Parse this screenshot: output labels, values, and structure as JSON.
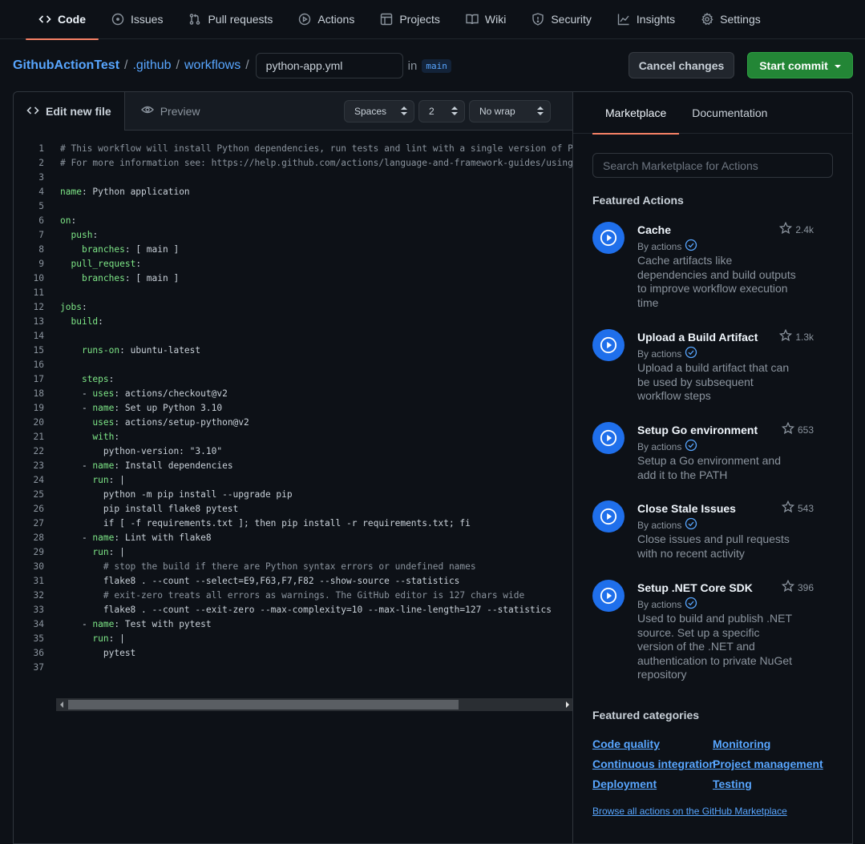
{
  "nav": {
    "tabs": [
      {
        "label": "Code",
        "icon": "code-icon",
        "active": true
      },
      {
        "label": "Issues",
        "icon": "issue-icon"
      },
      {
        "label": "Pull requests",
        "icon": "pull-request-icon"
      },
      {
        "label": "Actions",
        "icon": "play-icon"
      },
      {
        "label": "Projects",
        "icon": "table-icon"
      },
      {
        "label": "Wiki",
        "icon": "book-icon"
      },
      {
        "label": "Security",
        "icon": "shield-icon"
      },
      {
        "label": "Insights",
        "icon": "graph-icon"
      },
      {
        "label": "Settings",
        "icon": "gear-icon"
      }
    ]
  },
  "breadcrumb": {
    "repo": "GithubActionTest",
    "dir1": ".github",
    "dir2": "workflows",
    "sep": "/",
    "filename": "python-app.yml",
    "in_label": "in",
    "branch": "main"
  },
  "actions": {
    "cancel": "Cancel changes",
    "commit": "Start commit"
  },
  "editor": {
    "tab_edit": "Edit new file",
    "tab_preview": "Preview",
    "indent_mode": "Spaces",
    "indent_size": "2",
    "wrap_mode": "No wrap",
    "lines": [
      "# This workflow will install Python dependencies, run tests and lint with a single version of Pyt",
      "# For more information see: https://help.github.com/actions/language-and-framework-guides/using-p",
      "",
      "name: Python application",
      "",
      "on:",
      "  push:",
      "    branches: [ main ]",
      "  pull_request:",
      "    branches: [ main ]",
      "",
      "jobs:",
      "  build:",
      "",
      "    runs-on: ubuntu-latest",
      "",
      "    steps:",
      "    - uses: actions/checkout@v2",
      "    - name: Set up Python 3.10",
      "      uses: actions/setup-python@v2",
      "      with:",
      "        python-version: \"3.10\"",
      "    - name: Install dependencies",
      "      run: |",
      "        python -m pip install --upgrade pip",
      "        pip install flake8 pytest",
      "        if [ -f requirements.txt ]; then pip install -r requirements.txt; fi",
      "    - name: Lint with flake8",
      "      run: |",
      "        # stop the build if there are Python syntax errors or undefined names",
      "        flake8 . --count --select=E9,F63,F7,F82 --show-source --statistics",
      "        # exit-zero treats all errors as warnings. The GitHub editor is 127 chars wide",
      "        flake8 . --count --exit-zero --max-complexity=10 --max-line-length=127 --statistics",
      "    - name: Test with pytest",
      "      run: |",
      "        pytest",
      ""
    ]
  },
  "sidebar": {
    "tab_marketplace": "Marketplace",
    "tab_docs": "Documentation",
    "search_placeholder": "Search Marketplace for Actions",
    "featured_title": "Featured Actions",
    "by_label": "By actions",
    "items": [
      {
        "name": "Cache",
        "stars": "2.4k",
        "desc": "Cache artifacts like dependencies and build outputs to improve workflow execution time"
      },
      {
        "name": "Upload a Build Artifact",
        "stars": "1.3k",
        "desc": "Upload a build artifact that can be used by subsequent workflow steps"
      },
      {
        "name": "Setup Go environment",
        "stars": "653",
        "desc": "Setup a Go environment and add it to the PATH"
      },
      {
        "name": "Close Stale Issues",
        "stars": "543",
        "desc": "Close issues and pull requests with no recent activity"
      },
      {
        "name": "Setup .NET Core SDK",
        "stars": "396",
        "desc": "Used to build and publish .NET source. Set up a specific version of the .NET and authentication to private NuGet repository"
      }
    ],
    "categories_title": "Featured categories",
    "categories": [
      "Code quality",
      "Monitoring",
      "Continuous integration",
      "Project management",
      "Deployment",
      "Testing"
    ],
    "browse_link": "Browse all actions on the GitHub Marketplace"
  },
  "colors": {
    "background": "#0d1117",
    "link": "#58a6ff",
    "commit_button": "#238636",
    "active_tab_underline": "#f78166",
    "yaml_key": "#7ee787"
  }
}
